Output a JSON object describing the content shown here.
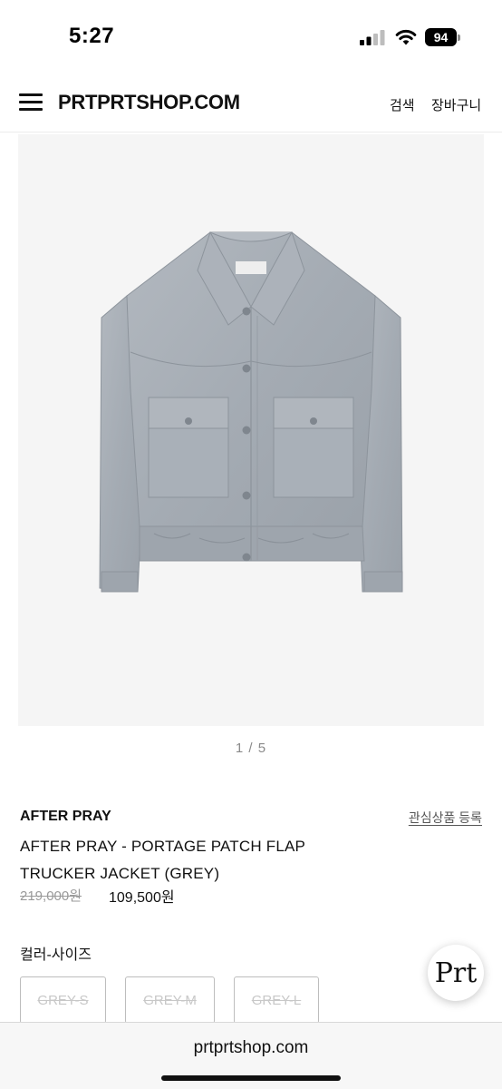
{
  "status_bar": {
    "time": "5:27",
    "battery": "94",
    "icons": [
      "signal-icon",
      "wifi-icon",
      "battery-icon"
    ]
  },
  "header": {
    "logo": "PRTPRTSHOP.COM",
    "search": "검색",
    "cart": "장바구니",
    "menu_icon": "hamburger-menu-icon"
  },
  "gallery": {
    "counter": "1 / 5",
    "image": "grey-trucker-jacket"
  },
  "product": {
    "brand": "AFTER PRAY",
    "wishlist": "관심상품 등록",
    "title": "AFTER PRAY - PORTAGE PATCH FLAP TRUCKER JACKET (GREY)",
    "original_price": "219,000원",
    "sale_price": "109,500원"
  },
  "options": {
    "label": "컬러-사이즈",
    "items": [
      "GREY-S",
      "GREY-M",
      "GREY-L"
    ]
  },
  "floating_badge": {
    "text": "Prt"
  },
  "browser": {
    "url": "prtprtshop.com"
  },
  "colors": {
    "jacket": "#a6adb5",
    "image_bg": "#f5f5f5",
    "text": "#111111"
  }
}
